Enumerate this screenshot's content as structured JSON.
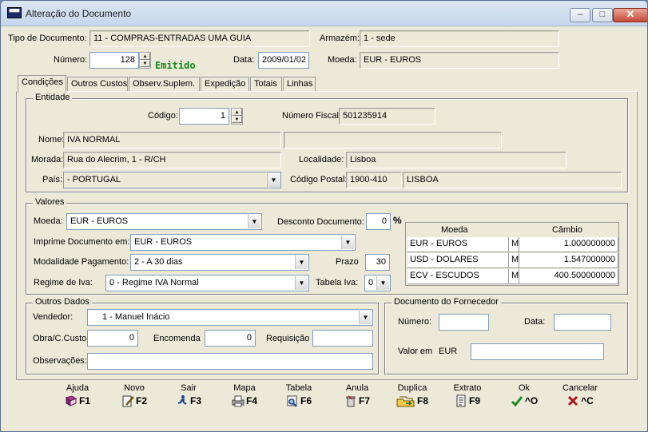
{
  "window": {
    "title": "Alteração do Documento",
    "icon_text": "■■■"
  },
  "header": {
    "tipo_documento_label": "Tipo de Documento:",
    "tipo_documento_value": "11 - COMPRAS-ENTRADAS UMA GUIA",
    "armazem_label": "Armazém:",
    "armazem_value": "1 - sede",
    "numero_label": "Número:",
    "numero_value": "128",
    "status": "Emitido",
    "data_label": "Data:",
    "data_value": "2009/01/02",
    "moeda_label": "Moeda:",
    "moeda_value": "EUR - EUROS"
  },
  "tabs": [
    {
      "label": "Condições"
    },
    {
      "label": "Outros Custos"
    },
    {
      "label": "Observ.Suplem."
    },
    {
      "label": "Expedição"
    },
    {
      "label": "Totais"
    },
    {
      "label": "Linhas"
    }
  ],
  "entidade": {
    "title": "Entidade",
    "codigo_label": "Código:",
    "codigo_value": "1",
    "nif_label": "Número Fiscal:",
    "nif_value": "501235914",
    "nome_label": "Nome:",
    "nome_value": "IVA NORMAL",
    "nome_extra_value": "",
    "morada_label": "Morada:",
    "morada_value": "Rua do Alecrim, 1 - R/CH",
    "localidade_label": "Localidade:",
    "localidade_value": "Lisboa",
    "pais_label": "País:",
    "pais_value": "- PORTUGAL",
    "cp_label": "Código Postal:",
    "cp_value": "1900-410",
    "cp_local_value": "LISBOA"
  },
  "valores": {
    "title": "Valores",
    "moeda_label": "Moeda:",
    "moeda_value": "EUR - EUROS",
    "desconto_label": "Desconto Documento:",
    "desconto_value": "0",
    "desconto_unit": "%",
    "imprime_label": "Imprime Documento em:",
    "imprime_value": "EUR - EUROS",
    "modalidade_label": "Modalidade Pagamento:",
    "modalidade_value": "2 - A 30 dias",
    "prazo_label": "Prazo",
    "prazo_value": "30",
    "regime_label": "Regime de Iva:",
    "regime_value": "0 - Regime IVA Normal",
    "tabela_label": "Tabela Iva:",
    "tabela_value": "0",
    "cambio_headers": {
      "moeda": "Moeda",
      "cambio": "Câmbio"
    },
    "cambio_rows": [
      {
        "moeda": "EUR - EUROS",
        "flag": "M",
        "cambio": "1.000000000"
      },
      {
        "moeda": "USD - DOLARES",
        "flag": "M",
        "cambio": "1.547000000"
      },
      {
        "moeda": "ECV - ESCUDOS",
        "flag": "M",
        "cambio": "400.500000000"
      }
    ]
  },
  "outros": {
    "title": "Outros Dados",
    "vendedor_label": "Vendedor:",
    "vendedor_value": "1 - Manuel Inácio",
    "obra_label": "Obra/C.Custo",
    "obra_value": "0",
    "encomenda_label": "Encomenda",
    "encomenda_value": "0",
    "requisicao_label": "Requisição",
    "requisicao_value": "",
    "observacoes_label": "Observações:",
    "observacoes_value": ""
  },
  "fornecedor": {
    "title": "Documento do Fornecedor",
    "numero_label": "Número:",
    "numero_value": "",
    "data_label": "Data:",
    "data_value": "",
    "valor_label": "Valor em",
    "valor_currency": "EUR",
    "valor_value": ""
  },
  "toolbar": [
    {
      "label": "Ajuda",
      "key": "F1",
      "icon": "help-book-icon"
    },
    {
      "label": "Novo",
      "key": "F2",
      "icon": "new-document-icon"
    },
    {
      "label": "Sair",
      "key": "F3",
      "icon": "exit-icon"
    },
    {
      "label": "Mapa",
      "key": "F4",
      "icon": "print-map-icon"
    },
    {
      "label": "Tabela",
      "key": "F6",
      "icon": "table-search-icon"
    },
    {
      "label": "Anula",
      "key": "F7",
      "icon": "trash-icon"
    },
    {
      "label": "Duplica",
      "key": "F8",
      "icon": "duplicate-folder-icon"
    },
    {
      "label": "Extrato",
      "key": "F9",
      "icon": "document-list-icon"
    },
    {
      "label": "Ok",
      "key": "^O",
      "icon": "check-icon"
    },
    {
      "label": "Cancelar",
      "key": "^C",
      "icon": "cancel-x-icon"
    }
  ],
  "colors": {
    "status_green": "#138a1b",
    "window_bg": "#ece9d8",
    "field_border": "#7f9db9"
  }
}
